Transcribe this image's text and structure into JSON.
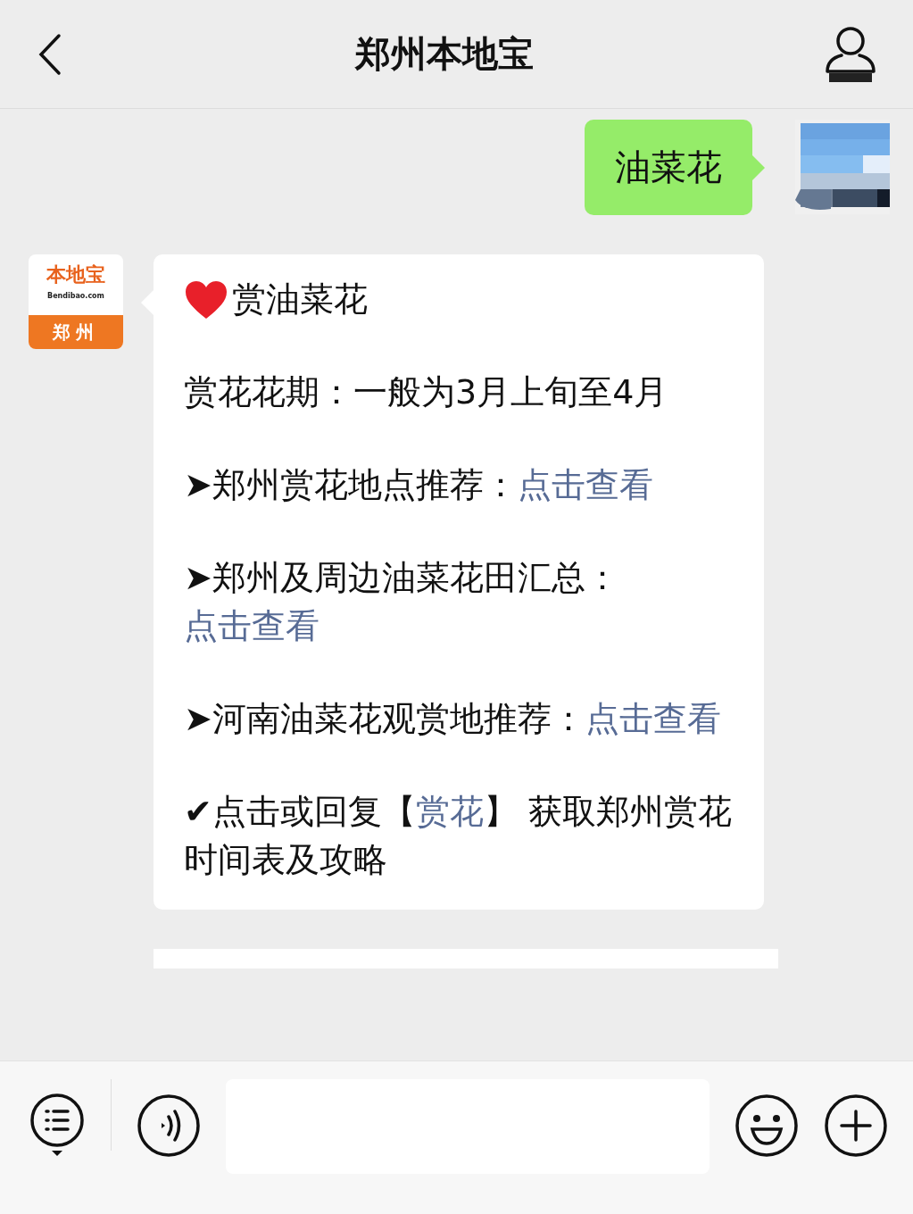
{
  "header": {
    "title": "郑州本地宝"
  },
  "messages": [
    {
      "kind": "outgoing",
      "text": "油菜花"
    },
    {
      "kind": "incoming",
      "avatar": {
        "logo_top": "本地宝",
        "logo_site": "Bendibao.com",
        "logo_city": "郑州"
      },
      "title": "赏油菜花",
      "paragraphs": [
        {
          "parts": [
            {
              "text": "赏花花期：一般为3月上旬至4月",
              "link": false
            }
          ]
        },
        {
          "parts": [
            {
              "text": "➤郑州赏花地点推荐：",
              "link": false
            },
            {
              "text": "点击查看",
              "link": true
            }
          ]
        },
        {
          "parts": [
            {
              "text": "➤郑州及周边油菜花田汇总：",
              "link": false
            },
            {
              "text": "点击查看",
              "link": true
            }
          ]
        },
        {
          "parts": [
            {
              "text": "➤河南油菜花观赏地推荐：",
              "link": false
            },
            {
              "text": "点击查看",
              "link": true
            }
          ]
        },
        {
          "parts": [
            {
              "text": "✔点击或回复【",
              "link": false
            },
            {
              "text": "赏花",
              "link": true
            },
            {
              "text": "】 获取郑州赏花时间表及攻略",
              "link": false
            }
          ]
        }
      ]
    },
    {
      "kind": "partial"
    }
  ]
}
